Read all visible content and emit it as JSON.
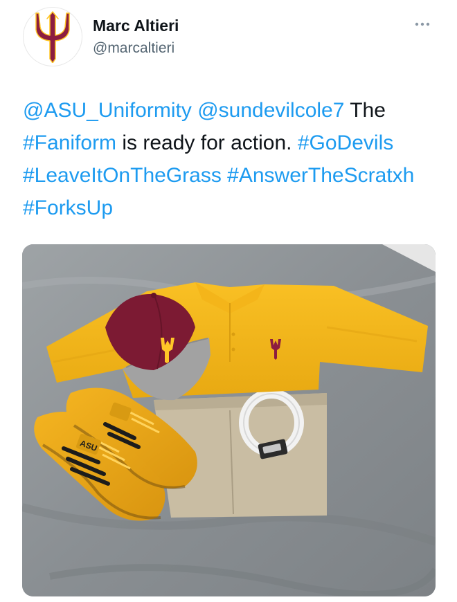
{
  "author": {
    "display_name": "Marc Altieri",
    "handle": "@marcaltieri",
    "avatar_icon": "pitchfork-logo-icon"
  },
  "menu": {
    "icon": "more-icon"
  },
  "tweet": {
    "segments": [
      {
        "text": "@ASU_Uniformity",
        "type": "mention"
      },
      {
        "text": " ",
        "type": "text"
      },
      {
        "text": "@sundevilcole7",
        "type": "mention"
      },
      {
        "text": " The ",
        "type": "text"
      },
      {
        "text": "#Faniform",
        "type": "hashtag"
      },
      {
        "text": " is ready for action. ",
        "type": "text"
      },
      {
        "text": "#GoDevils",
        "type": "hashtag"
      },
      {
        "text": " ",
        "type": "text"
      },
      {
        "text": "#LeaveItOnTheGrass",
        "type": "hashtag"
      },
      {
        "text": " ",
        "type": "text"
      },
      {
        "text": "#AnswerTheScratxh",
        "type": "hashtag"
      },
      {
        "text": " ",
        "type": "text"
      },
      {
        "text": "#ForksUp",
        "type": "hashtag"
      }
    ]
  },
  "media": {
    "type": "photo",
    "shirt_logo_icon": "pitchfork-logo-icon",
    "shoe_tongue_text": "ASU"
  },
  "colors": {
    "link": "#1d9bf0",
    "text": "#0f1419",
    "secondary": "#536471",
    "asu_maroon": "#8c1d40",
    "asu_gold": "#ffc627"
  }
}
